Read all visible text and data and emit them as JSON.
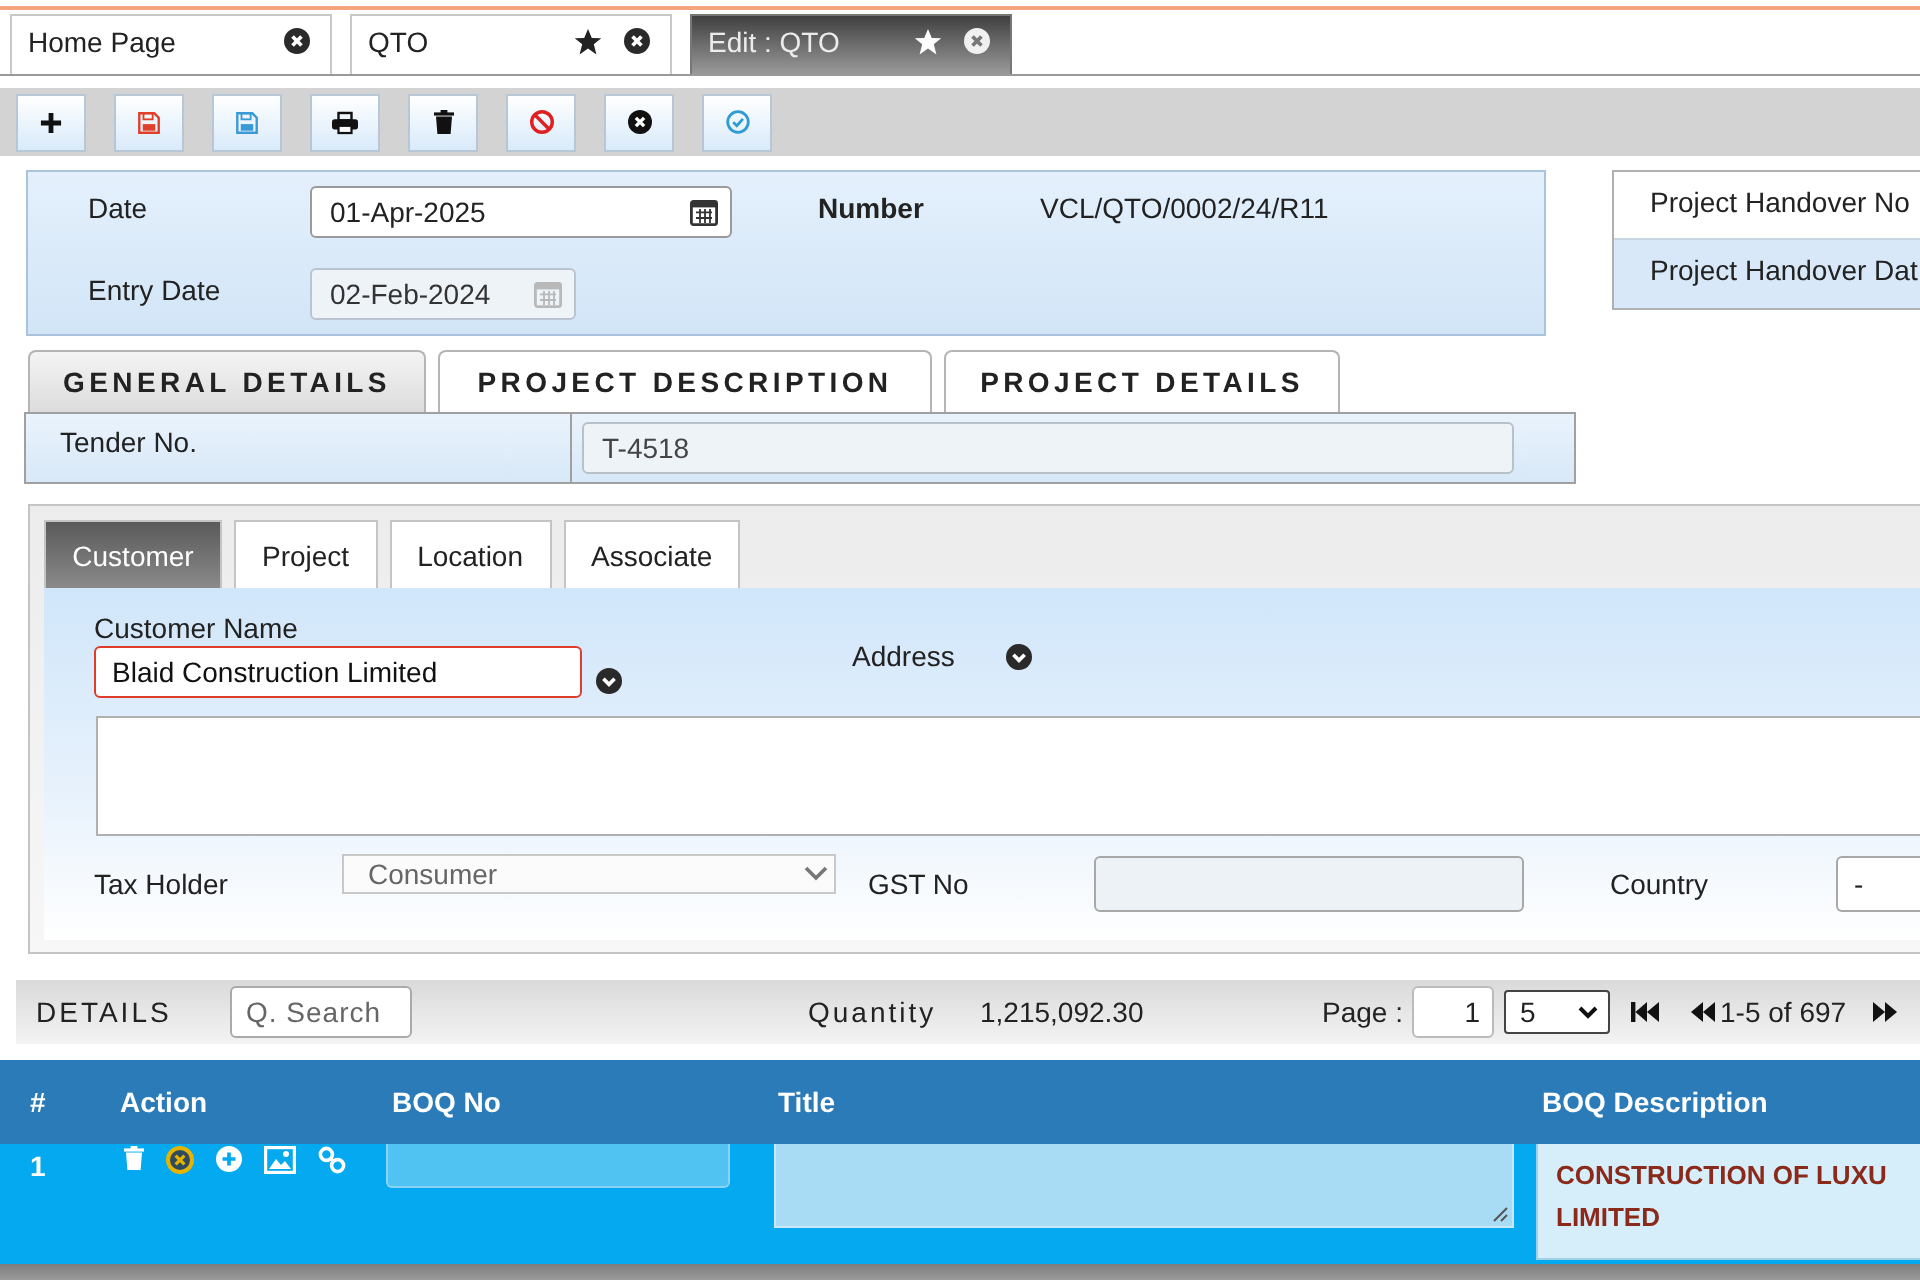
{
  "doc_tabs": [
    {
      "label": "Home Page",
      "starred": false,
      "selected": false
    },
    {
      "label": "QTO",
      "starred": true,
      "selected": false
    },
    {
      "label": "Edit : QTO",
      "starred": true,
      "selected": true
    }
  ],
  "toolbar": [
    {
      "kind": "add"
    },
    {
      "kind": "save"
    },
    {
      "kind": "saveas"
    },
    {
      "kind": "print"
    },
    {
      "kind": "delete"
    },
    {
      "kind": "cancel"
    },
    {
      "kind": "close"
    },
    {
      "kind": "approve"
    }
  ],
  "header": {
    "date": {
      "label": "Date",
      "value": "01-Apr-2025",
      "disabled": false
    },
    "entry_date": {
      "label": "Entry Date",
      "value": "02-Feb-2024",
      "disabled": true
    },
    "number": {
      "label": "Number",
      "value": "VCL/QTO/0002/24/R11"
    }
  },
  "handover": [
    {
      "label": "Project Handover No",
      "highlighted": false
    },
    {
      "label": "Project Handover Dat",
      "highlighted": true
    }
  ],
  "section_tabs": [
    {
      "label": "GENERAL DETAILS",
      "selected": true
    },
    {
      "label": "PROJECT DESCRIPTION",
      "selected": false
    },
    {
      "label": "PROJECT DETAILS",
      "selected": false
    }
  ],
  "tender": {
    "label": "Tender No.",
    "value": "T-4518"
  },
  "customer_tabs": [
    {
      "label": "Customer",
      "selected": true
    },
    {
      "label": "Project",
      "selected": false
    },
    {
      "label": "Location",
      "selected": false
    },
    {
      "label": "Associate",
      "selected": false
    }
  ],
  "customer": {
    "name_label": "Customer Name",
    "name_value": "Blaid Construction Limited",
    "name_invalid": true,
    "address_label": "Address",
    "tax_holder_label": "Tax Holder",
    "tax_holder_value": "Consumer",
    "tax_holder_disabled": true,
    "gst_label": "GST No",
    "gst_disabled": true,
    "country_label": "Country",
    "country_value": "-"
  },
  "details": {
    "title": "DETAILS",
    "search_placeholder": "Q. Search",
    "quantity_label": "Quantity",
    "quantity_value": "1,215,092.30",
    "page_label": "Page :",
    "page_value": "1",
    "page_size": "5",
    "range": "1-5 of 697"
  },
  "table": {
    "columns": [
      "#",
      "Action",
      "BOQ No",
      "Title",
      "BOQ Description"
    ],
    "rows": [
      {
        "index": "1",
        "actions": [
          {
            "kind": "delete"
          },
          {
            "kind": "remove"
          },
          {
            "kind": "add"
          },
          {
            "kind": "image"
          },
          {
            "kind": "link"
          }
        ],
        "description": "CONSTRUCTION OF LUXU\nLIMITED"
      }
    ]
  }
}
